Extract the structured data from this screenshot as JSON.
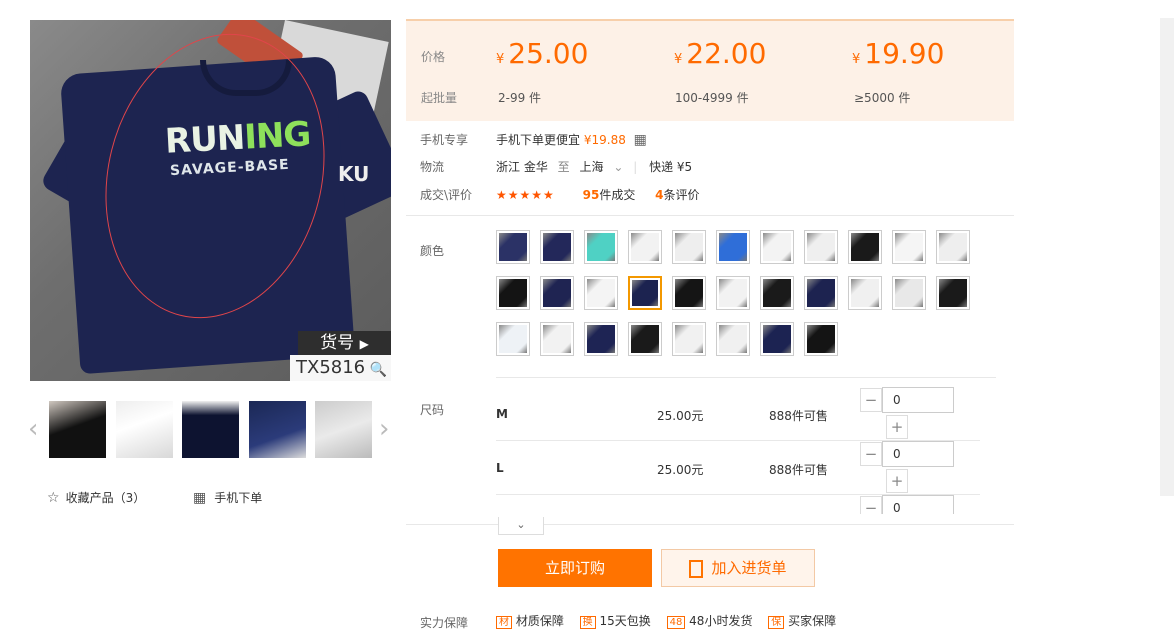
{
  "gallery": {
    "main_image": {
      "alt": "navy running t-shirt",
      "shirt_text_1a": "RUN",
      "shirt_text_1b": "ING",
      "shirt_text_2": "SAVAGE-BASE",
      "sleeve_mark": "KU"
    },
    "item_code_label": "货号",
    "item_code_value": "TX5816",
    "prev_icon": "chevron-left-icon",
    "next_icon": "chevron-right-icon",
    "thumbnails": [
      "thumb-black-shirt",
      "thumb-white-shirt",
      "thumb-navy-collar",
      "thumb-navy-sleeve",
      "thumb-grey-shirt"
    ]
  },
  "actions_left": {
    "favorite_label": "收藏产品（3）",
    "mobile_order_label": "手机下单"
  },
  "price_box": {
    "price_label": "价格",
    "min_qty_label": "起批量",
    "currency": "¥",
    "tiers": [
      {
        "price": "25.00",
        "qty": "2-99 件"
      },
      {
        "price": "22.00",
        "qty": "100-4999 件"
      },
      {
        "price": "19.90",
        "qty": "≥5000 件"
      }
    ]
  },
  "info": {
    "mobile_label": "手机专享",
    "mobile_text": "手机下单更便宜",
    "mobile_price": "¥19.88",
    "logistics_label": "物流",
    "from": "浙江 金华",
    "to_word": "至",
    "to": "上海",
    "shipping": "快递 ¥5",
    "deals_label": "成交\\评价",
    "stars": "★★★★★",
    "deal_count": "95",
    "deal_unit": "件成交",
    "review_count": "4",
    "review_unit": "条评价"
  },
  "color": {
    "label": "颜色",
    "selected_index": 14,
    "swatches": [
      "#2b3266",
      "#23285a",
      "#4fd1c4",
      "#f2f2f2",
      "#eeeeee",
      "#2f6ed8",
      "#f3f3f3",
      "#efefef",
      "#1a1a1a",
      "#f5f5f5",
      "#eeeeee",
      "#141414",
      "#1f2452",
      "#f4f4f4",
      "#1c2350",
      "#151515",
      "#f2f2f2",
      "#1a1a1a",
      "#1d2350",
      "#f0f0f0",
      "#e8e8e8",
      "#1a1a1a",
      "#eef2f6",
      "#f2f2f2",
      "#1e2454",
      "#1a1a1a",
      "#f1f1f1",
      "#f0f0f0",
      "#1c2352",
      "#141414"
    ]
  },
  "sizes": {
    "label": "尺码",
    "rows": [
      {
        "size": "M",
        "price": "25.00元",
        "stock": "888件可售",
        "value": "0"
      },
      {
        "size": "L",
        "price": "25.00元",
        "stock": "888件可售",
        "value": "0"
      },
      {
        "size": "",
        "price": "",
        "stock": "",
        "value": "0"
      }
    ],
    "expand_icon": "chevron-down-icon"
  },
  "buttons": {
    "order_now": "立即订购",
    "add_to_cart": "加入进货单"
  },
  "guarantee": {
    "label": "实力保障",
    "items": [
      "材质保障",
      "15天包换",
      "48小时发货",
      "买家保障"
    ]
  }
}
